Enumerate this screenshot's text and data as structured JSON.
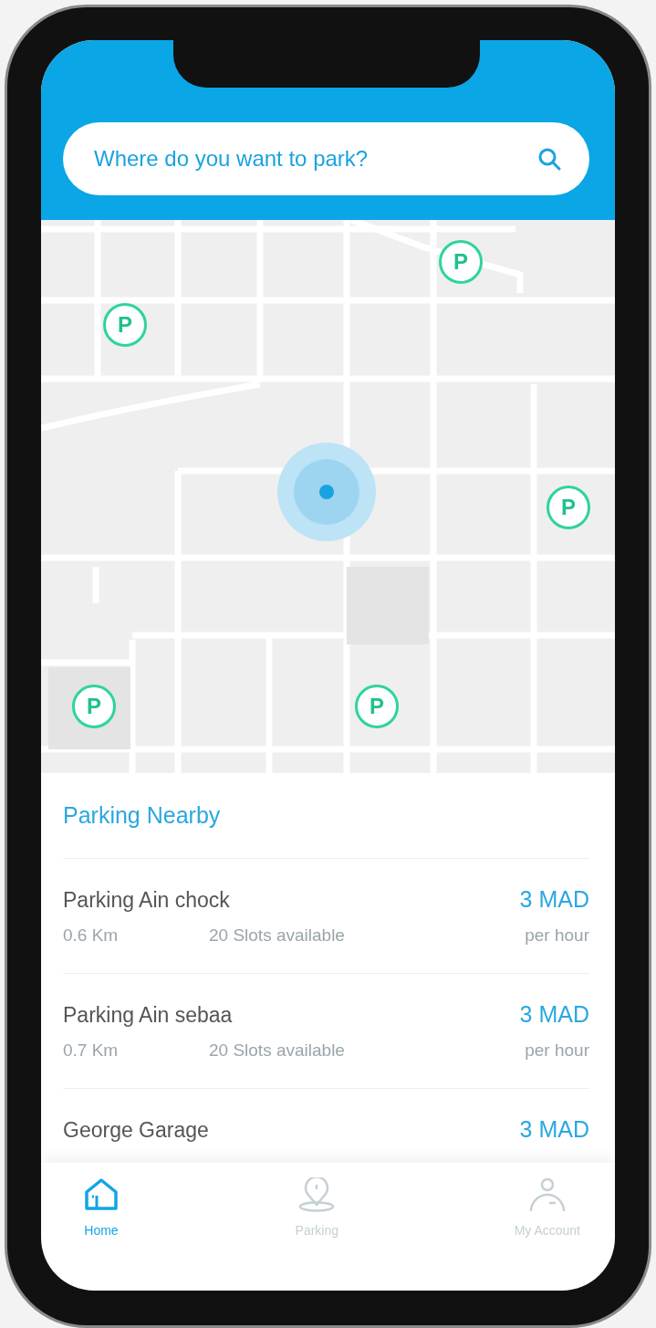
{
  "search": {
    "placeholder": "Where do you want to park?"
  },
  "map": {
    "markers": [
      {
        "label": "P"
      },
      {
        "label": "P"
      },
      {
        "label": "P"
      },
      {
        "label": "P"
      },
      {
        "label": "P"
      }
    ]
  },
  "nearby": {
    "title": "Parking Nearby",
    "items": [
      {
        "name": "Parking Ain chock",
        "distance": "0.6 Km",
        "slots": "20 Slots available",
        "price": "3 MAD",
        "unit": "per hour"
      },
      {
        "name": "Parking Ain sebaa",
        "distance": "0.7 Km",
        "slots": "20 Slots available",
        "price": "3 MAD",
        "unit": "per hour"
      },
      {
        "name": "George Garage",
        "price": "3 MAD"
      }
    ]
  },
  "nav": [
    {
      "kind": "home",
      "label": "Home",
      "selected": true
    },
    {
      "kind": "pin",
      "label": "Parking",
      "selected": false
    },
    {
      "kind": "account",
      "label": "My Account",
      "selected": false
    }
  ]
}
